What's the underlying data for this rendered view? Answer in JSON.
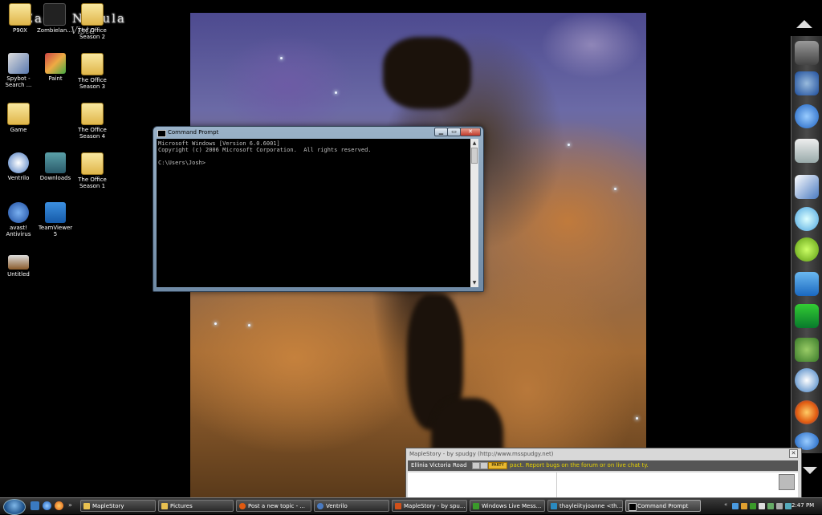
{
  "wallpaper": {
    "logo": "Eagle Nebula",
    "logo_sub": "Vista"
  },
  "desktop_icons": [
    {
      "label": "P90X",
      "icon": "folder-icon"
    },
    {
      "label": "Zombielan...",
      "icon": "movie-icon"
    },
    {
      "label": "The Office Season 2",
      "icon": "folder-icon"
    },
    {
      "label": "Spybot - Search ...",
      "icon": "spybot-icon"
    },
    {
      "label": "Paint",
      "icon": "paint-icon"
    },
    {
      "label": "The Office Season 3",
      "icon": "folder-icon"
    },
    {
      "label": "Game",
      "icon": "folder-icon"
    },
    {
      "label": "The Office Season 4",
      "icon": "folder-icon"
    },
    {
      "label": "Ventrilo",
      "icon": "ventrilo-icon"
    },
    {
      "label": "Downloads",
      "icon": "downloads-icon"
    },
    {
      "label": "The Office Season 1",
      "icon": "folder-icon"
    },
    {
      "label": "avast! Antivirus",
      "icon": "avast-icon"
    },
    {
      "label": "TeamViewer 5",
      "icon": "teamviewer-icon"
    },
    {
      "label": "Untitled",
      "icon": "image-icon"
    }
  ],
  "cmd": {
    "title": "Command Prompt",
    "line1": "Microsoft Windows [Version 6.0.6001]",
    "line2": "Copyright (c) 2006 Microsoft Corporation.  All rights reserved.",
    "line3": "",
    "line4": "C:\\Users\\Josh>",
    "min_label": "▁",
    "max_label": "▭",
    "close_label": "✕"
  },
  "maplestory_notifier": {
    "title": "MapleStory - by spudgy (http://www.msspudgy.net)",
    "location": "Ellinia  Victoria Road",
    "tag": "PARTY",
    "message": "pact. Report bugs on the forum or on live chat ty."
  },
  "taskbar": {
    "items": [
      {
        "label": "MapleStory",
        "icon": "folder-icon"
      },
      {
        "label": "Pictures",
        "icon": "folder-icon"
      },
      {
        "label": "Post a new topic - ...",
        "icon": "firefox-icon"
      },
      {
        "label": "Ventrilo",
        "icon": "ventrilo-icon"
      },
      {
        "label": "MapleStory - by spu...",
        "icon": "maple-icon"
      },
      {
        "label": "Windows Live Mess...",
        "icon": "messenger-icon"
      },
      {
        "label": "thayleiityjoanne <th...",
        "icon": "chat-icon"
      },
      {
        "label": "Command Prompt",
        "icon": "cmd-icon",
        "active": true
      }
    ],
    "clock": "2:47 PM"
  },
  "colors": {
    "taskbar_bg": "#1a1a1a",
    "cmd_bg": "#000000",
    "cmd_text": "#c0c0c0",
    "notifier_msg": "#e8d300"
  }
}
